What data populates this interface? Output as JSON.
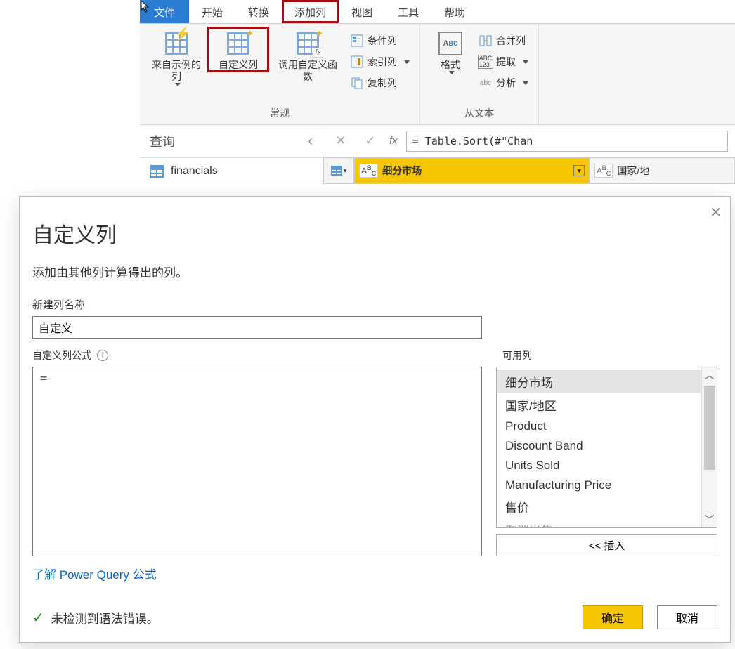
{
  "ribbon": {
    "tabs": {
      "file": "文件",
      "home": "开始",
      "transform": "转换",
      "add_column": "添加列",
      "view": "视图",
      "tools": "工具",
      "help": "帮助"
    },
    "group1": {
      "from_examples": "来自示例的列",
      "custom_column": "自定义列",
      "invoke_custom": "调用自定义函数",
      "conditional": "条件列",
      "index": "索引列",
      "duplicate": "复制列",
      "label": "常规"
    },
    "group2": {
      "format": "格式",
      "merge": "合并列",
      "extract": "提取",
      "parse": "分析",
      "label": "从文本"
    }
  },
  "query": {
    "header": "查询",
    "item1": "financials"
  },
  "formula_bar": {
    "text": "= Table.Sort(#\"Chan"
  },
  "preview": {
    "col1": "细分市场",
    "col2": "国家/地"
  },
  "dialog": {
    "title": "自定义列",
    "subtitle": "添加由其他列计算得出的列。",
    "new_col_label": "新建列名称",
    "new_col_value": "自定义",
    "formula_label": "自定义列公式",
    "formula_value": "=",
    "available_label": "可用列",
    "available": [
      "细分市场",
      "国家/地区",
      "Product",
      "Discount Band",
      "Units Sold",
      "Manufacturing Price",
      "售价",
      "取消出售"
    ],
    "insert": "<< 插入",
    "link": "了解 Power Query 公式",
    "status": "未检测到语法错误。",
    "ok": "确定",
    "cancel": "取消"
  },
  "icons": {
    "abc": "ABC",
    "abc123": "ABC\n123"
  }
}
